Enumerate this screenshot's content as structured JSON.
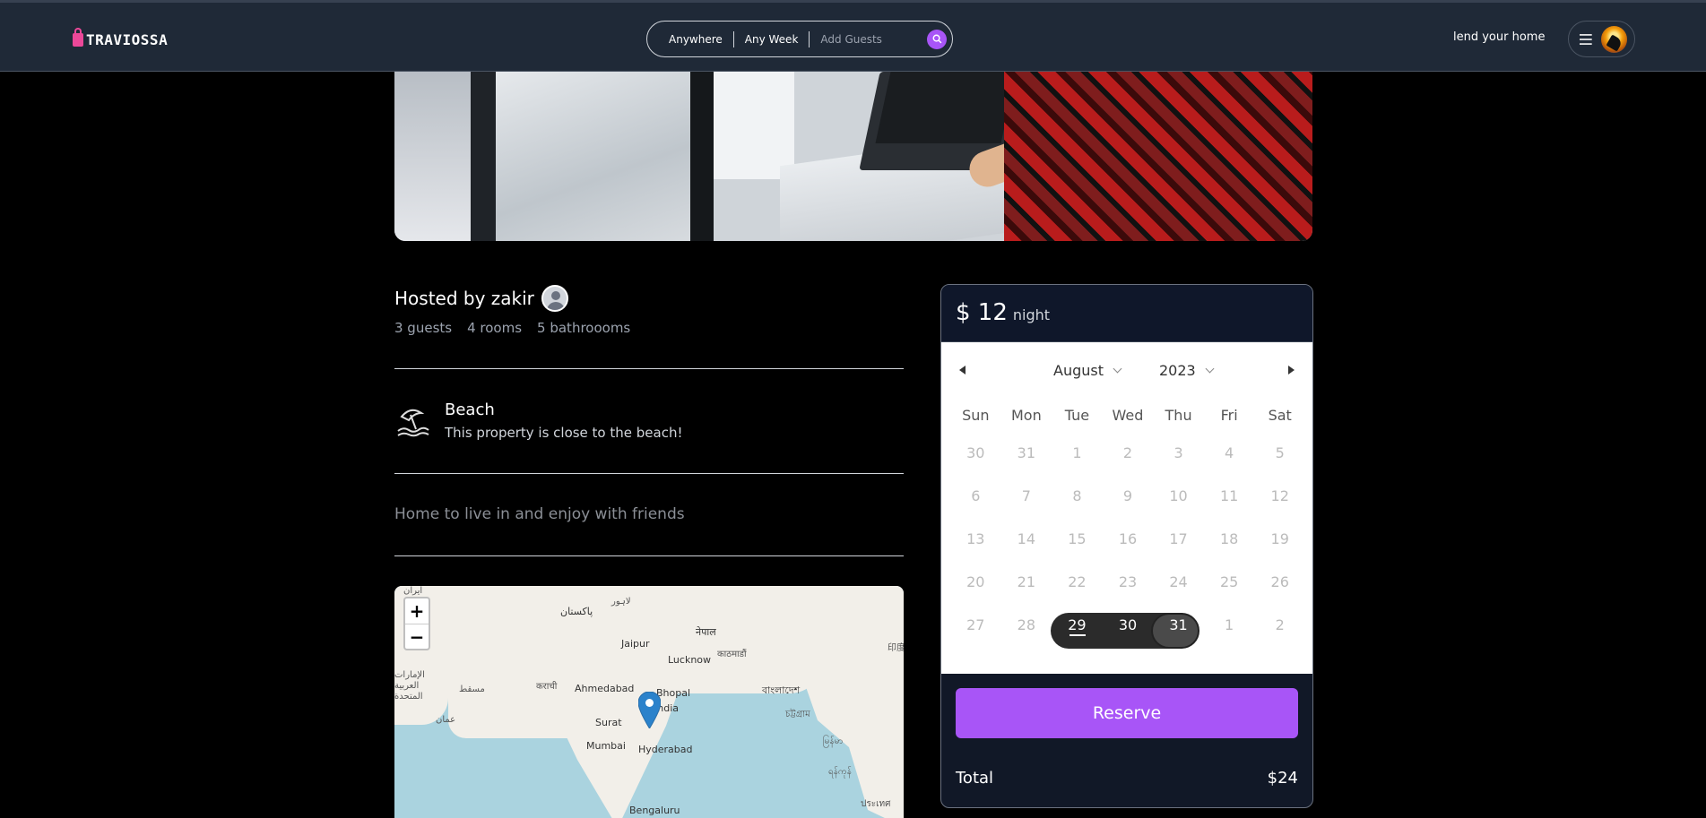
{
  "brand": {
    "name": "TRAVIOSSA",
    "accent": "#a855f7",
    "logo_color": "#ec4899"
  },
  "search": {
    "where": "Anywhere",
    "when": "Any Week",
    "guests": "Add Guests"
  },
  "nav": {
    "lend_label": "lend your home"
  },
  "listing": {
    "host_title": "Hosted by zakir",
    "stats": [
      "3 guests",
      "4 rooms",
      "5 bathroooms"
    ],
    "category": {
      "title": "Beach",
      "description": "This property is close to the beach!"
    },
    "description": "Home to live in and enjoy with friends"
  },
  "map": {
    "zoom_in": "+",
    "zoom_out": "−",
    "labels": [
      "ایران",
      "پاکستان",
      "لاہور",
      "नेपाल",
      "काठमाडौं",
      "Jaipur",
      "Lucknow",
      "कराची",
      "الإمارات العربية المتحدة",
      "مسقط",
      "عمان",
      "Ahmedabad",
      "Bhopal",
      "India",
      "Surat",
      "Mumbai",
      "Hyderabad",
      "বাংলাদেশ",
      "চট্টগ্রাম",
      "Bengaluru",
      "မြန်မာ",
      "ရန်ကုန်",
      "ประเทศ",
      "印度"
    ]
  },
  "booking": {
    "price": "$ 12",
    "per": "night",
    "month": "August",
    "year": "2023",
    "weekdays": [
      "Sun",
      "Mon",
      "Tue",
      "Wed",
      "Thu",
      "Fri",
      "Sat"
    ],
    "days": [
      "30",
      "31",
      "1",
      "2",
      "3",
      "4",
      "5",
      "6",
      "7",
      "8",
      "9",
      "10",
      "11",
      "12",
      "13",
      "14",
      "15",
      "16",
      "17",
      "18",
      "19",
      "20",
      "21",
      "22",
      "23",
      "24",
      "25",
      "26",
      "27",
      "28",
      "29",
      "30",
      "31",
      "1",
      "2"
    ],
    "selected_range": [
      "29",
      "31"
    ],
    "reserve_label": "Reserve",
    "total_label": "Total",
    "total_value": "$24"
  }
}
